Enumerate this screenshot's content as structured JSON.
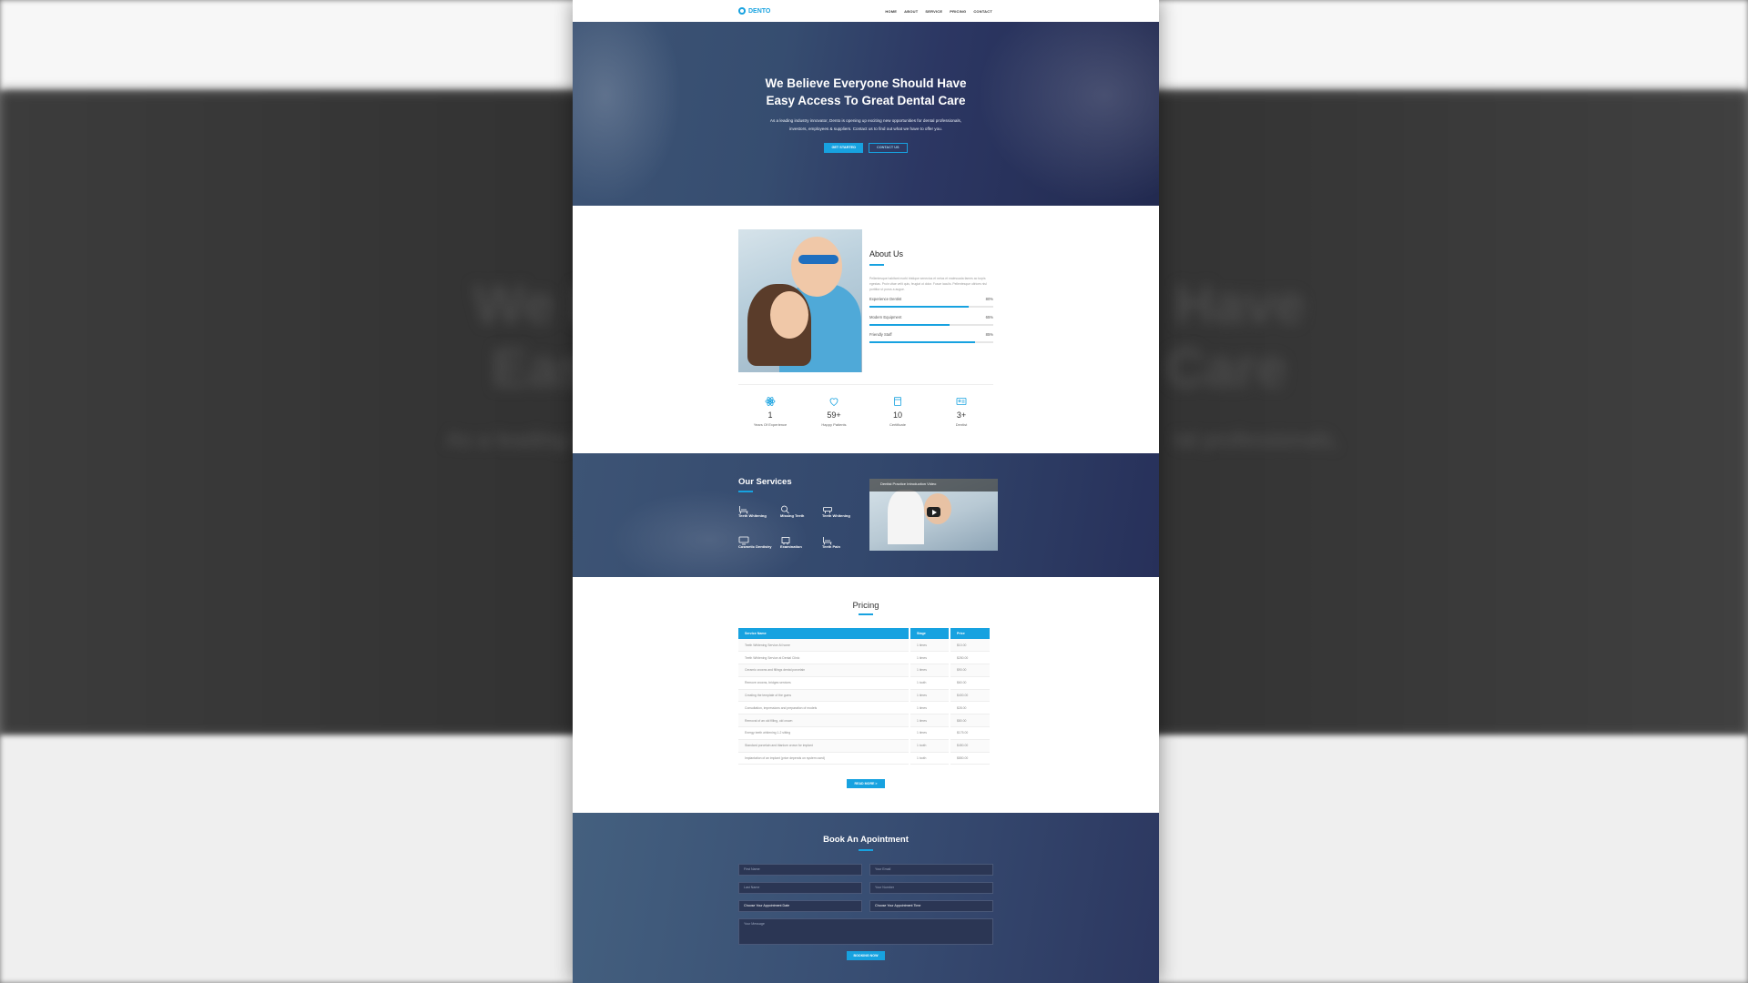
{
  "brand": {
    "name": "DENTO"
  },
  "nav": {
    "items": [
      "HOME",
      "ABOUT",
      "SERVICE",
      "PRICING",
      "CONTACT"
    ]
  },
  "hero": {
    "title_line1": "We Believe Everyone Should Have",
    "title_line2": "Easy Access To Great Dental Care",
    "desc_line1": "As a leading industry innovator, Dento is opening up exciting new opportunities for dental professionals,",
    "desc_line2": "investors, employees & suppliers. Contact us to find out what we have to offer you.",
    "cta_primary": "GET STARTED",
    "cta_secondary": "CONTACT US"
  },
  "about": {
    "title": "About Us",
    "description": "Pellentesque habitant morbi tristique senectus et netus et malesuada fames ac turpis egestas. Proin vitae velit quis, feugiat ut dolor. Fusce iaculis. Pellentesque ultrices nisl porttitor ut purus a augue.",
    "skills": [
      {
        "label": "Experience Dentist",
        "percent": 80,
        "percent_text": "80%"
      },
      {
        "label": "Modern Equipment",
        "percent": 65,
        "percent_text": "65%"
      },
      {
        "label": "Friendly Staff",
        "percent": 85,
        "percent_text": "85%"
      }
    ],
    "stats": [
      {
        "icon": "atom-icon",
        "value": "1",
        "label": "Years Of Experience"
      },
      {
        "icon": "heart-icon",
        "value": "59+",
        "label": "Happy Patients"
      },
      {
        "icon": "certificate-icon",
        "value": "10",
        "label": "Certificate"
      },
      {
        "icon": "id-card-icon",
        "value": "3+",
        "label": "Dentist"
      }
    ]
  },
  "services": {
    "title": "Our Services",
    "items": [
      {
        "label": "Teeth Whitening",
        "icon": "dental-chair-icon"
      },
      {
        "label": "Missing Teeth",
        "icon": "magnifier-icon"
      },
      {
        "label": "Teeth Whitening",
        "icon": "tooth-brush-icon"
      },
      {
        "label": "Cosmetic Dentistry",
        "icon": "monitor-icon"
      },
      {
        "label": "Examination",
        "icon": "xray-icon"
      },
      {
        "label": "Teeth Pain",
        "icon": "dental-chair-icon"
      }
    ],
    "video": {
      "title": "Dentist Practice Introduction Video"
    }
  },
  "pricing": {
    "title": "Pricing",
    "headers": [
      "Service Name",
      "Stage",
      "Price"
    ],
    "rows": [
      [
        "Teeth Whitening Service At home",
        "1 times",
        "$10.00"
      ],
      [
        "Teeth Whitening Service at Dental Clinic",
        "1 times",
        "$250.00"
      ],
      [
        "Ceramic crowns and fillings dental porcelain",
        "1 times",
        "$90.00"
      ],
      [
        "Remove crowns, bridges services",
        "1 tooth",
        "$60.00"
      ],
      [
        "Creating the template of the gums",
        "1 times",
        "$400.00"
      ],
      [
        "Consultation, impressions and preparation of models",
        "1 times",
        "$28.00"
      ],
      [
        "Removal of an old filling, old crown",
        "1 times",
        "$80.00"
      ],
      [
        "Energy teeth whitening 1-2 sitting",
        "1 times",
        "$175.00"
      ],
      [
        "Standard porcelain and titanium crown for implant",
        "1 tooth",
        "$450.00"
      ],
      [
        "Implantation of an implant (price depends on system used)",
        "1 tooth",
        "$850.00"
      ]
    ],
    "read_more": "READ MORE >"
  },
  "booking": {
    "title": "Book An Apointment",
    "fields": [
      {
        "placeholder": "First Name"
      },
      {
        "placeholder": "Your Email"
      },
      {
        "placeholder": "Last Name"
      },
      {
        "placeholder": "Your Number"
      }
    ],
    "date_select": "Choose Your Appointment Date",
    "time_select": "Choose Your Appointment Time",
    "message_placeholder": "Your Message",
    "submit": "BOOKING NOW"
  },
  "backdrop": {
    "title_left": "We B",
    "title_left2": "Eas",
    "title_right": "Have",
    "title_right2": "Care",
    "sub_left": "As a leading industry in",
    "sub_right": "tal professionals,"
  },
  "colors": {
    "accent": "#17a2e0",
    "hero_dark": "#2c3763"
  }
}
